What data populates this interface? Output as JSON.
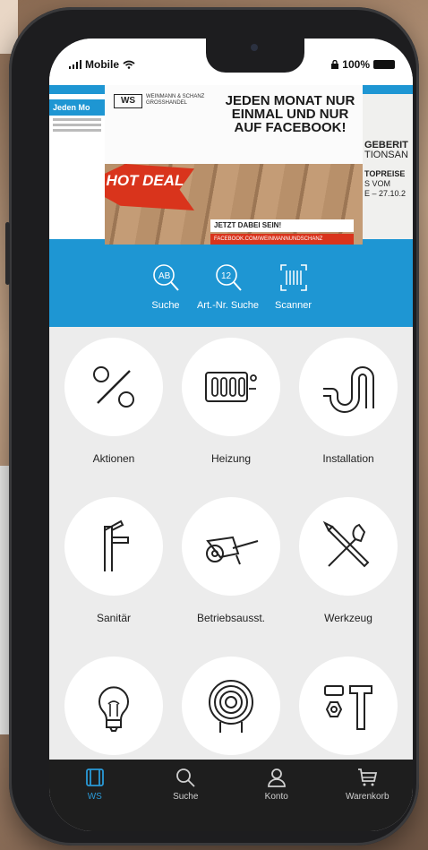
{
  "status_bar": {
    "carrier": "Mobile",
    "battery": "100%"
  },
  "banner": {
    "brand_logo": "WS",
    "brand_name": "WEINMANN & SCHANZ GROSSHANDEL",
    "headline": "JEDEN MONAT NUR EINMAL UND NUR AUF FACEBOOK!",
    "badge": "HOT DEAL",
    "cta": "JETZT DABEI SEIN!",
    "cta_sub": "FACEBOOK.COM/WEINMANNUNDSCHANZ",
    "left_card": "Jeden Mo",
    "right_card": {
      "title": "GEBERIT",
      "subtitle": "TIONSAN",
      "line1": "TOPREISE",
      "line2": "S VOM",
      "line3": "E – 27.10.2"
    }
  },
  "quick_actions": [
    {
      "label": "Suche",
      "icon": "text-search-icon"
    },
    {
      "label": "Art.-Nr. Suche",
      "icon": "number-search-icon"
    },
    {
      "label": "Scanner",
      "icon": "barcode-scanner-icon"
    }
  ],
  "categories": [
    {
      "label": "Aktionen",
      "icon": "percent-icon"
    },
    {
      "label": "Heizung",
      "icon": "radiator-icon"
    },
    {
      "label": "Installation",
      "icon": "pipe-icon"
    },
    {
      "label": "Sanitär",
      "icon": "faucet-icon"
    },
    {
      "label": "Betriebsausst.",
      "icon": "wheelbarrow-icon"
    },
    {
      "label": "Werkzeug",
      "icon": "tools-icon"
    },
    {
      "label": "",
      "icon": "lightbulb-icon"
    },
    {
      "label": "",
      "icon": "cable-reel-icon"
    },
    {
      "label": "",
      "icon": "fasteners-icon"
    }
  ],
  "tabs": [
    {
      "label": "WS",
      "icon": "tablet-icon",
      "active": true
    },
    {
      "label": "Suche",
      "icon": "search-icon",
      "active": false
    },
    {
      "label": "Konto",
      "icon": "user-icon",
      "active": false
    },
    {
      "label": "Warenkorb",
      "icon": "cart-icon",
      "active": false
    }
  ],
  "colors": {
    "accent": "#1e96d3",
    "active_tab": "#2a9ad8",
    "tabbar": "#1e1e1e",
    "hot_deal": "#d9341c"
  }
}
